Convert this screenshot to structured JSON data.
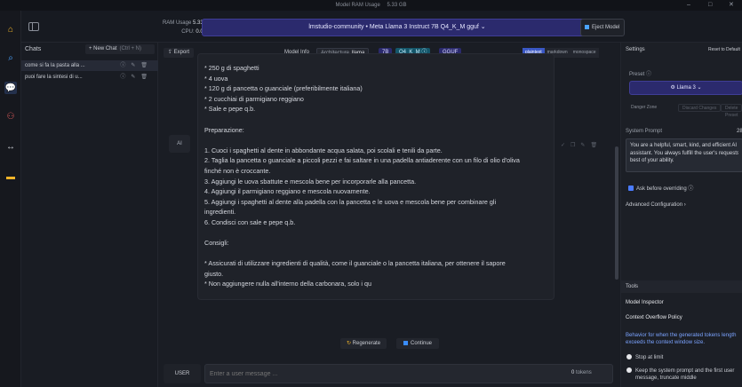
{
  "window": {
    "title": "Model RAM Usage",
    "ram_value": "5.33 GB"
  },
  "header": {
    "ram_label": "RAM Usage",
    "ram_value": "5.33 GB",
    "cpu_label": "CPU:",
    "cpu_value": "0.00 %",
    "model_select": "lmstudio-community • Meta Llama 3 Instruct 7B Q4_K_M gguf",
    "eject_label": "Eject Model"
  },
  "sidebar": {
    "title": "Chats",
    "new_chat": "+ New Chat",
    "new_chat_shortcut": "(Ctrl + N)",
    "items": [
      {
        "label": "come si fa la pasta alla ..."
      },
      {
        "label": "puoi fare la sintesi di u..."
      }
    ]
  },
  "toolbar": {
    "export": "Export",
    "model_info": "Model Info",
    "architecture_label": "Architecture",
    "architecture_value": "llama",
    "size": "7B",
    "quant": "Q4_K_M",
    "format": "GGUF",
    "view_modes": [
      "plaintext",
      "markdown",
      "monospace"
    ]
  },
  "message": {
    "role": "AI",
    "lines": [
      "* 250 g di spaghetti",
      "* 4 uova",
      "* 120 g di pancetta o guanciale (preferibilmente italiana)",
      "* 2 cucchiai di parmigiano reggiano",
      "* Sale e pepe q.b.",
      "",
      "Preparazione:",
      "",
      "1. Cuoci i spaghetti al dente in abbondante acqua salata, poi scolali e tenili da parte.",
      "2. Taglia la pancetta o guanciale a piccoli pezzi e fai saltare in una padella antiaderente con un filo di olio d'oliva",
      "finché non è croccante.",
      "3. Aggiungi le uova sbattute e mescola bene per incorporarle alla pancetta.",
      "4. Aggiungi il parmigiano reggiano e mescola nuovamente.",
      "5. Aggiungi i spaghetti al dente alla padella con la pancetta e le uova e mescola bene per combinare gli",
      "ingredienti.",
      "6. Condisci con sale e pepe q.b.",
      "",
      "Consigli:",
      "",
      "* Assicurati di utilizzare ingredienti di qualità, come il guanciale o la pancetta italiana, per ottenere il sapore",
      "giusto.",
      "* Non aggiungere nulla all'interno della carbonara, solo i qu"
    ]
  },
  "actions": {
    "regenerate": "Regenerate",
    "continue": "Continue"
  },
  "input": {
    "role": "USER",
    "placeholder": "Enter a user message ...",
    "tokens_value": "0",
    "tokens_label": "tokens"
  },
  "settings": {
    "title": "Settings",
    "reset": "Reset to Default",
    "preset_label": "Preset",
    "preset_value": "Llama 3",
    "danger_zone": "Danger Zone",
    "discard_changes": "Discard Changes",
    "delete_preset": "Delete Preset",
    "system_prompt_label": "System Prompt",
    "system_prompt_count": "28",
    "system_prompt_lines": [
      "You are a helpful, smart, kind, and efficient AI",
      "assistant. You always fulfill the user's requests",
      "best of your ability."
    ],
    "ask_overriding": "Ask before overriding",
    "advanced": "Advanced Configuration",
    "tools": "Tools",
    "model_inspector": "Model Inspector",
    "context_overflow": "Context Overflow Policy",
    "overflow_desc_lines": [
      "Behavior for when the generated tokens length",
      "exceeds the context window size."
    ],
    "option_stop": "Stop at limit",
    "option_keep_lines": [
      "Keep the system prompt and the first user",
      "message, truncate middle"
    ]
  }
}
